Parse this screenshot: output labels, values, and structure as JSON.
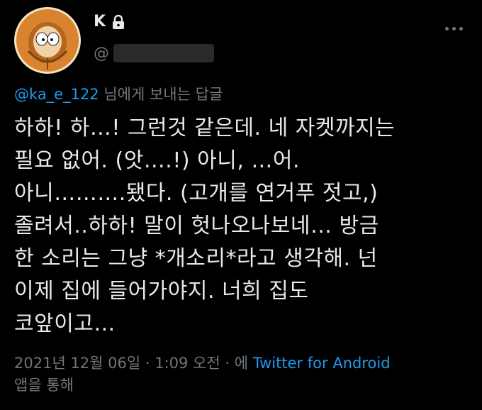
{
  "header": {
    "display_name": "K",
    "handle_prefix": "@",
    "lock_icon": "lock-icon",
    "more_icon": "more-options-icon"
  },
  "reply_context": {
    "mention": "@ka_e_122",
    "suffix": " 님에게 보내는 답글"
  },
  "tweet": {
    "lines": [
      "하하! 하…! 그런것 같은데. 네 자켓까지는",
      "필요 없어. (앗….!) 아니, …어.",
      "아니……….됐다. (고개를 연거푸 젓고,)",
      "졸려서..하하! 말이 헛나오나보네… 방금",
      "한 소리는 그냥 *개소리*라고 생각해. 넌",
      "이제 집에 들어가야지. 너희 집도",
      "코앞이고…"
    ]
  },
  "meta": {
    "timestamp": "2021년 12월 06일 · 1:09 오전 · 에 ",
    "source": "Twitter for Android",
    "suffix": "앱을 통해"
  },
  "colors": {
    "background": "#000000",
    "text": "#e7e9ea",
    "secondary": "#71767b",
    "link": "#1d9bf0",
    "avatar_parka": "#d9832e"
  }
}
